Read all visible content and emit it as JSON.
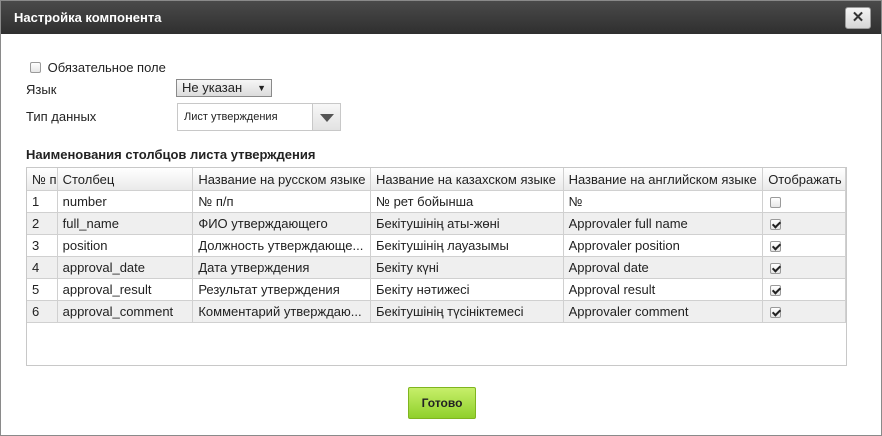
{
  "dialog": {
    "title": "Настройка компонента",
    "close_symbol": "✕",
    "required_field_label": "Обязательное поле",
    "required_checked": false,
    "language_label": "Язык",
    "language_value": "Не указан",
    "data_type_label": "Тип данных",
    "data_type_value": "Лист утверждения",
    "section_title": "Наименования столбцов листа утверждения",
    "done_label": "Готово"
  },
  "table": {
    "headers": [
      "№ п",
      "Столбец",
      "Название на русском языке",
      "Название на казахском языке",
      "Название на английском языке",
      "Отображать"
    ],
    "rows": [
      {
        "num": "1",
        "column": "number",
        "ru": "№ п/п",
        "kz": "№ рет бойынша",
        "en": "№",
        "show": false
      },
      {
        "num": "2",
        "column": "full_name",
        "ru": "ФИО утверждающего",
        "kz": "Бекітушінің аты-жөні",
        "en": "Approvaler full name",
        "show": true
      },
      {
        "num": "3",
        "column": "position",
        "ru": "Должность утверждающе...",
        "kz": "Бекітушінің лауазымы",
        "en": "Approvaler position",
        "show": true
      },
      {
        "num": "4",
        "column": "approval_date",
        "ru": "Дата утверждения",
        "kz": "Бекіту күні",
        "en": "Approval date",
        "show": true
      },
      {
        "num": "5",
        "column": "approval_result",
        "ru": "Результат утверждения",
        "kz": "Бекіту нәтижесі",
        "en": "Approval result",
        "show": true
      },
      {
        "num": "6",
        "column": "approval_comment",
        "ru": "Комментарий утверждаю...",
        "kz": "Бекітушінің түсініктемесі",
        "en": "Approvaler comment",
        "show": true
      }
    ]
  }
}
